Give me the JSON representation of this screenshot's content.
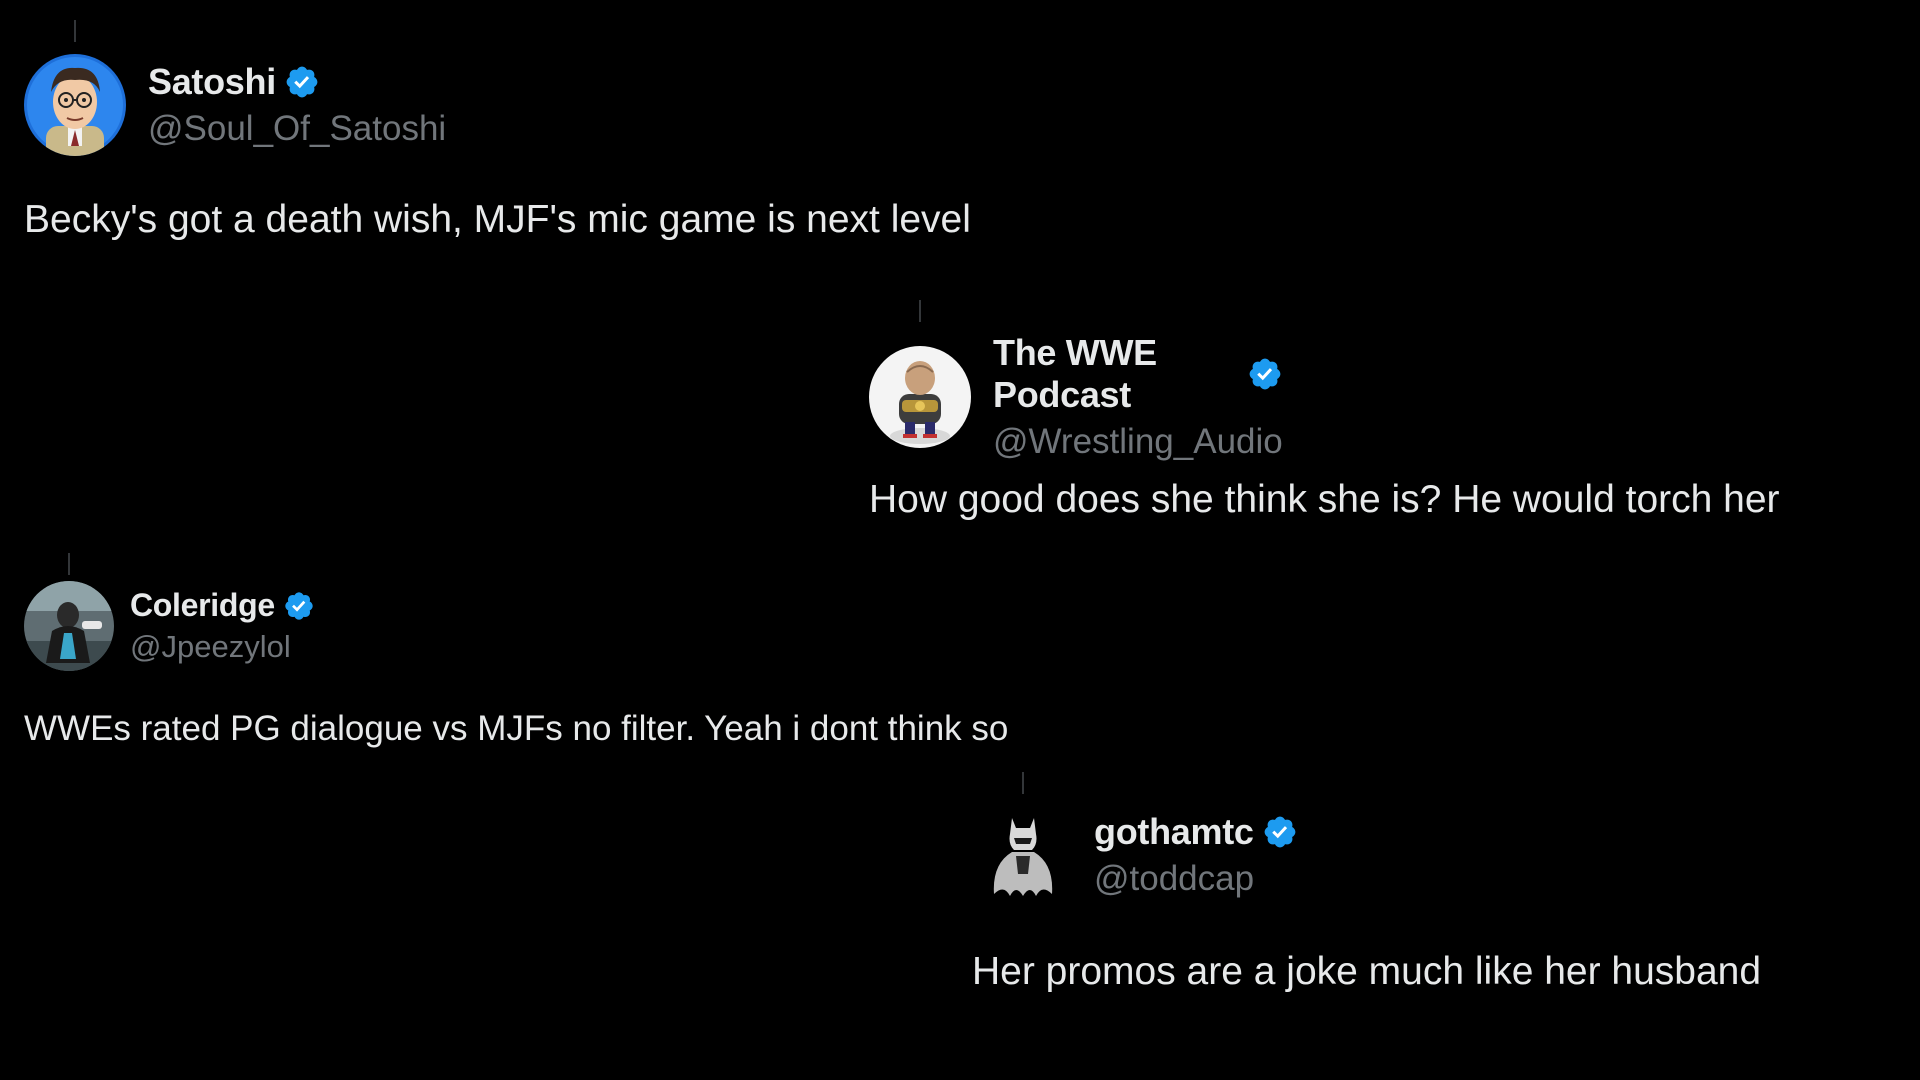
{
  "colors": {
    "background": "#000000",
    "text_primary": "#e7e9ea",
    "text_secondary": "#71767b",
    "verified_badge": "#1d9bf0",
    "thread_line": "#333639"
  },
  "tweets": [
    {
      "display_name": "Satoshi",
      "handle": "@Soul_Of_Satoshi",
      "verified": true,
      "avatar_icon": "cartoon-man-avatar",
      "text": "Becky's got a death wish, MJF's mic game is next level"
    },
    {
      "display_name": "The WWE Podcast",
      "handle": "@Wrestling_Audio",
      "verified": true,
      "avatar_icon": "wrestler-cartoon-avatar",
      "text": "How good does she think she is? He would torch her"
    },
    {
      "display_name": "Coleridge",
      "handle": "@Jpeezylol",
      "verified": true,
      "avatar_icon": "athlete-photo-avatar",
      "text": "WWEs rated PG dialogue vs MJFs no filter. Yeah i dont think so"
    },
    {
      "display_name": "gothamtc",
      "handle": "@toddcap",
      "verified": true,
      "avatar_icon": "batman-silhouette-avatar",
      "text": "Her promos are a joke much like her husband"
    }
  ]
}
